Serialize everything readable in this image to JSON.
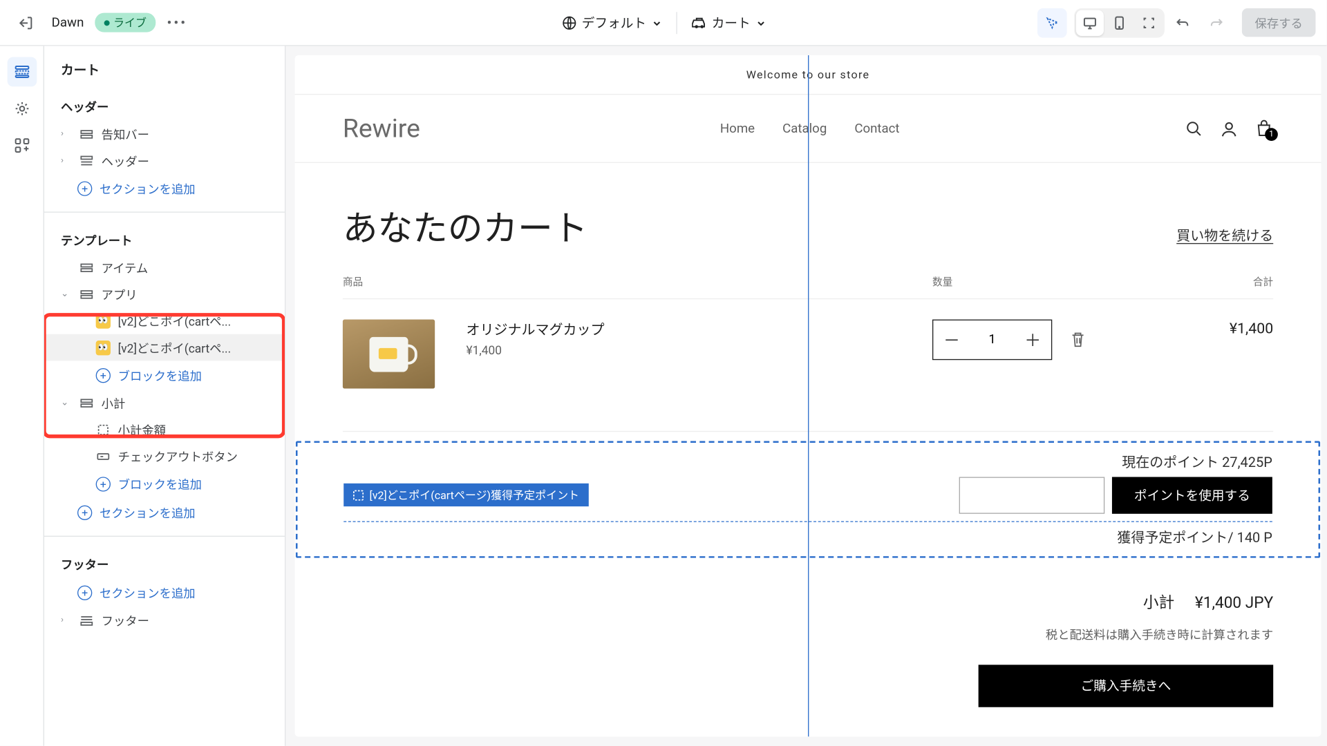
{
  "topbar": {
    "theme": "Dawn",
    "live": "ライブ",
    "default_label": "デフォルト",
    "cart_label": "カート",
    "save": "保存する"
  },
  "sidebar": {
    "title": "カート",
    "groups": {
      "header": "ヘッダー",
      "template": "テンプレート",
      "footer": "フッター"
    },
    "items": {
      "announcement": "告知バー",
      "header": "ヘッダー",
      "add_section": "セクションを追加",
      "items": "アイテム",
      "app": "アプリ",
      "app_block1": "[v2]どこポイ(cartペ...",
      "app_block2": "[v2]どこポイ(cartペ...",
      "add_block": "ブロックを追加",
      "subtotal": "小計",
      "subtotal_amount": "小計金額",
      "checkout_btn": "チェックアウトボタン",
      "footer": "フッター"
    }
  },
  "preview": {
    "announce": "Welcome to our store",
    "logo": "Rewire",
    "nav": {
      "home": "Home",
      "catalog": "Catalog",
      "contact": "Contact"
    },
    "cart_badge": "1",
    "cart_title": "あなたのカート",
    "continue": "買い物を続ける",
    "col_product": "商品",
    "col_qty": "数量",
    "col_total": "合計",
    "product": {
      "name": "オリジナルマグカップ",
      "price": "¥1,400",
      "qty": "1",
      "line_total": "¥1,400"
    },
    "block_label": "[v2]どこポイ(cartページ)獲得予定ポイント",
    "points_current": "現在のポイント 27,425P",
    "use_points_btn": "ポイントを使用する",
    "points_earn": "獲得予定ポイント/ 140 P",
    "subtotal_label": "小計",
    "subtotal_value": "¥1,400 JPY",
    "tax_note": "税と配送料は購入手続き時に計算されます",
    "checkout": "ご購入手続きへ"
  }
}
